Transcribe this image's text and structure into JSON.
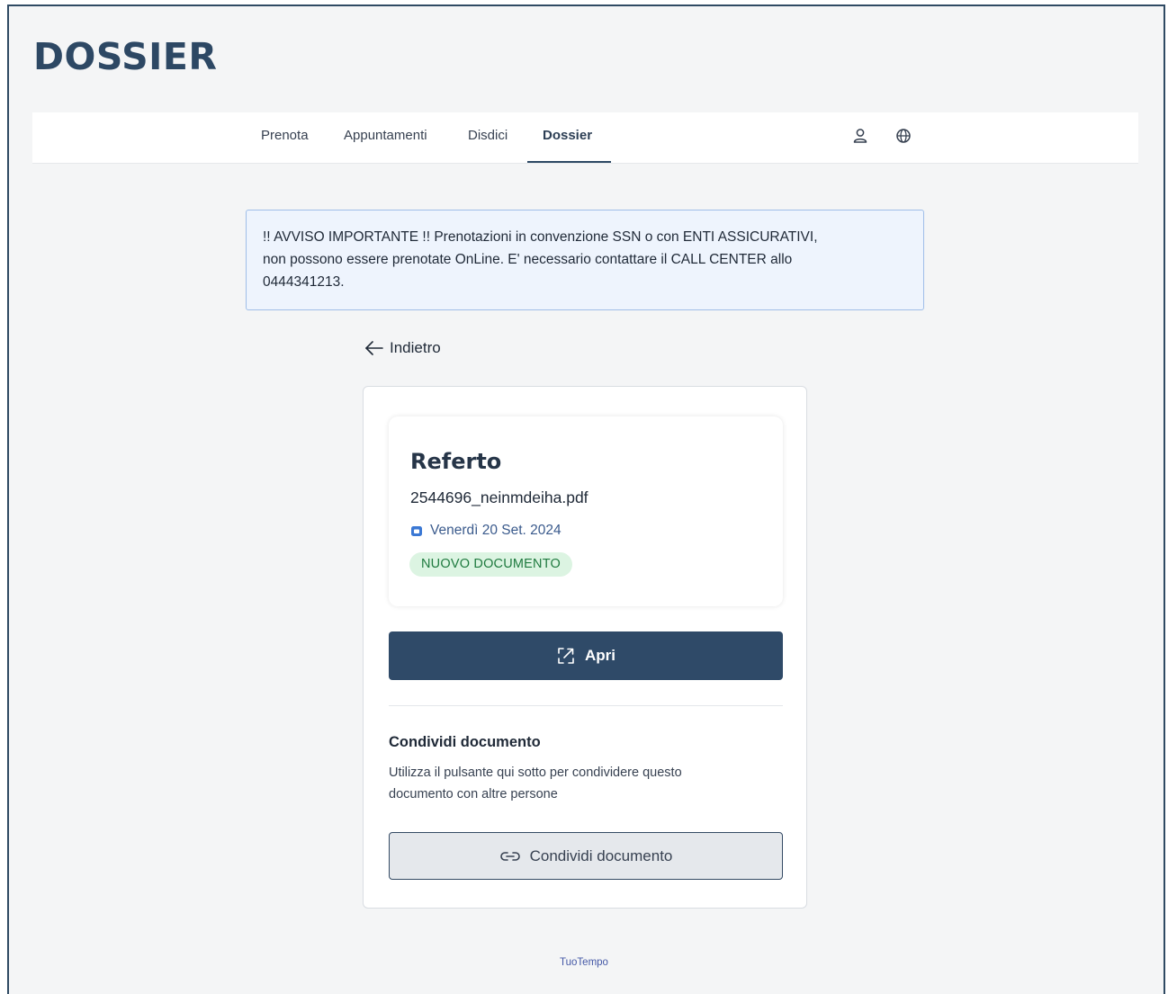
{
  "header": {
    "title": "DOSSIER"
  },
  "nav": {
    "items": [
      {
        "label": "Prenota"
      },
      {
        "label": "Appuntamenti"
      },
      {
        "label": "Disdici"
      },
      {
        "label": "Dossier",
        "active": true
      }
    ],
    "icons": [
      "user-icon",
      "globe-icon"
    ]
  },
  "alert": {
    "line1": "!! AVVISO IMPORTANTE !! Prenotazioni in convenzione SSN o con ENTI ASSICURATIVI,",
    "line2": "non possono essere prenotate OnLine. E' necessario contattare il CALL CENTER allo",
    "line3": "0444341213."
  },
  "back": {
    "label": "Indietro"
  },
  "document": {
    "type": "Referto",
    "filename": "2544696_neinmdeiha.pdf",
    "date": "Venerdì 20 Set. 2024",
    "badge": "NUOVO DOCUMENTO",
    "open_label": "Apri"
  },
  "share": {
    "title": "Condividi documento",
    "description_line1": "Utilizza il pulsante qui sotto per condividere questo",
    "description_line2": "documento con altre persone",
    "button_label": "Condividi documento"
  },
  "footer": {
    "label": "TuoTempo"
  },
  "colors": {
    "accent": "#2ac0e8",
    "brand": "#2f4a68",
    "alert_bg": "#eef4fd",
    "badge_bg": "#dcf4e2",
    "badge_text": "#1f7a3f"
  }
}
